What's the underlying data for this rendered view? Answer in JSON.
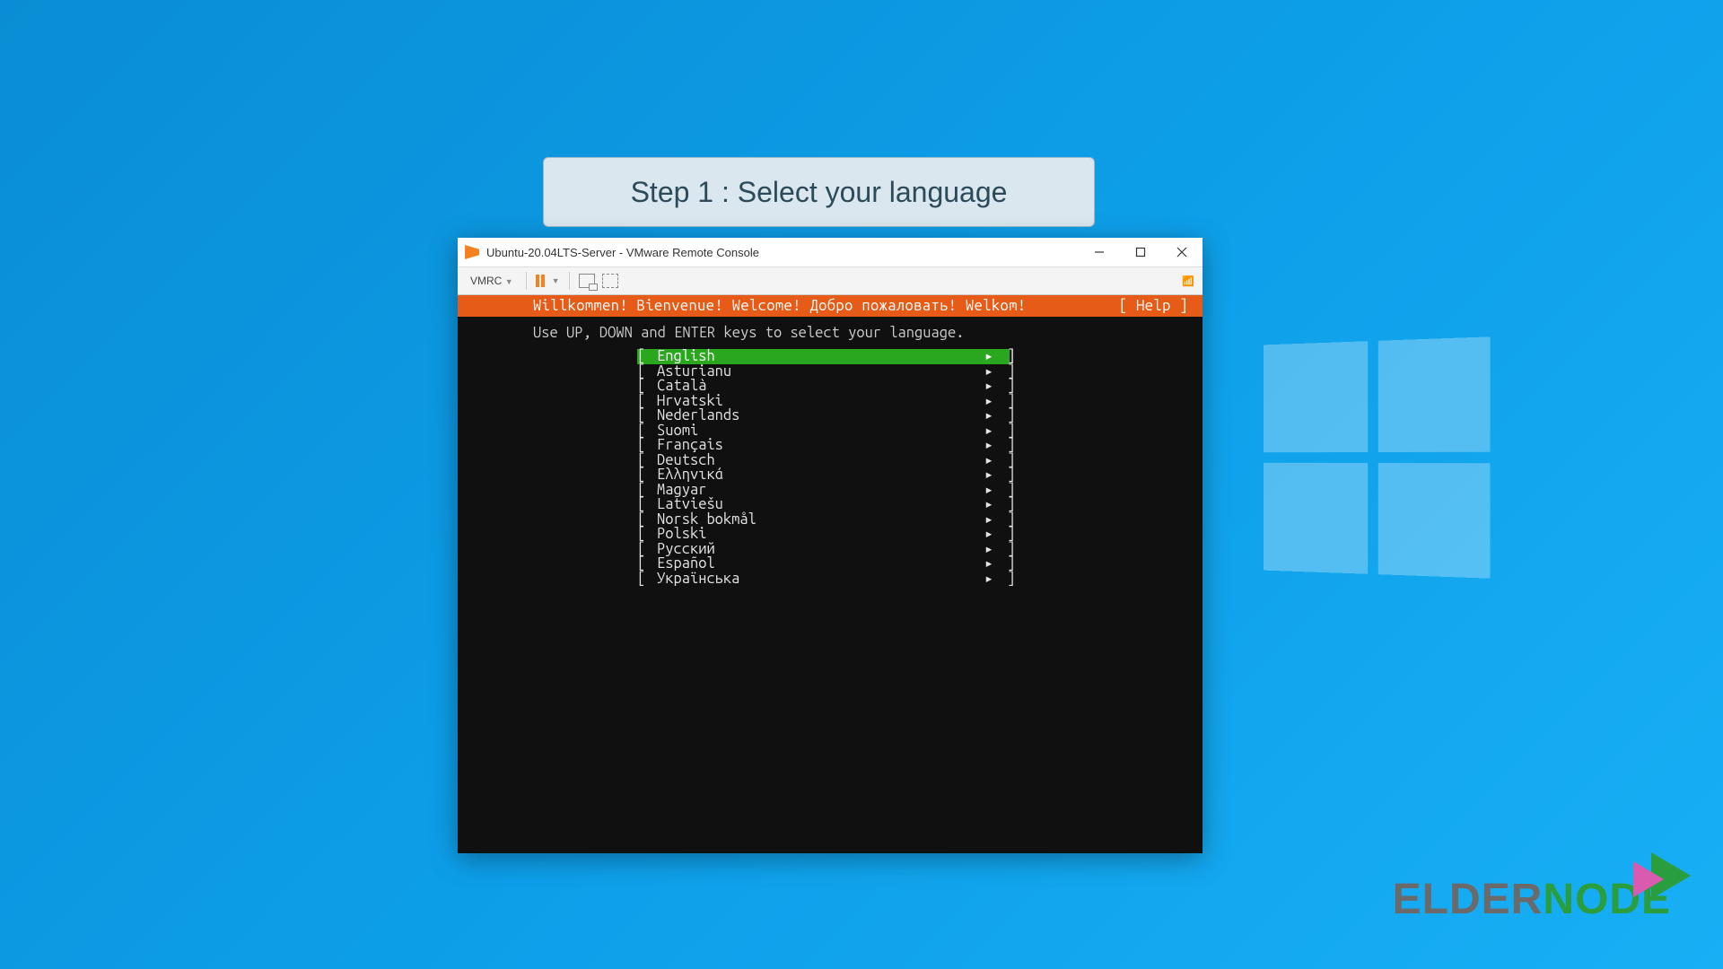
{
  "step_banner": "Step 1 : Select your language",
  "window": {
    "title": "Ubuntu-20.04LTS-Server - VMware Remote Console"
  },
  "toolbar": {
    "menu_label": "VMRC"
  },
  "console": {
    "greeting": "Willkommen! Bienvenue! Welcome! Добро пожаловать! Welkom!",
    "help": "[ Help ]",
    "instruction": "Use UP, DOWN and ENTER keys to select your language."
  },
  "languages": [
    {
      "name": "English",
      "selected": true
    },
    {
      "name": "Asturianu",
      "selected": false
    },
    {
      "name": "Català",
      "selected": false
    },
    {
      "name": "Hrvatski",
      "selected": false
    },
    {
      "name": "Nederlands",
      "selected": false
    },
    {
      "name": "Suomi",
      "selected": false
    },
    {
      "name": "Français",
      "selected": false
    },
    {
      "name": "Deutsch",
      "selected": false
    },
    {
      "name": "Ελληνικά",
      "selected": false
    },
    {
      "name": "Magyar",
      "selected": false
    },
    {
      "name": "Latviešu",
      "selected": false
    },
    {
      "name": "Norsk bokmål",
      "selected": false
    },
    {
      "name": "Polski",
      "selected": false
    },
    {
      "name": "Русский",
      "selected": false
    },
    {
      "name": "Español",
      "selected": false
    },
    {
      "name": "Українська",
      "selected": false
    }
  ],
  "watermark": {
    "part1": "ELDER",
    "part2": "NODE"
  }
}
